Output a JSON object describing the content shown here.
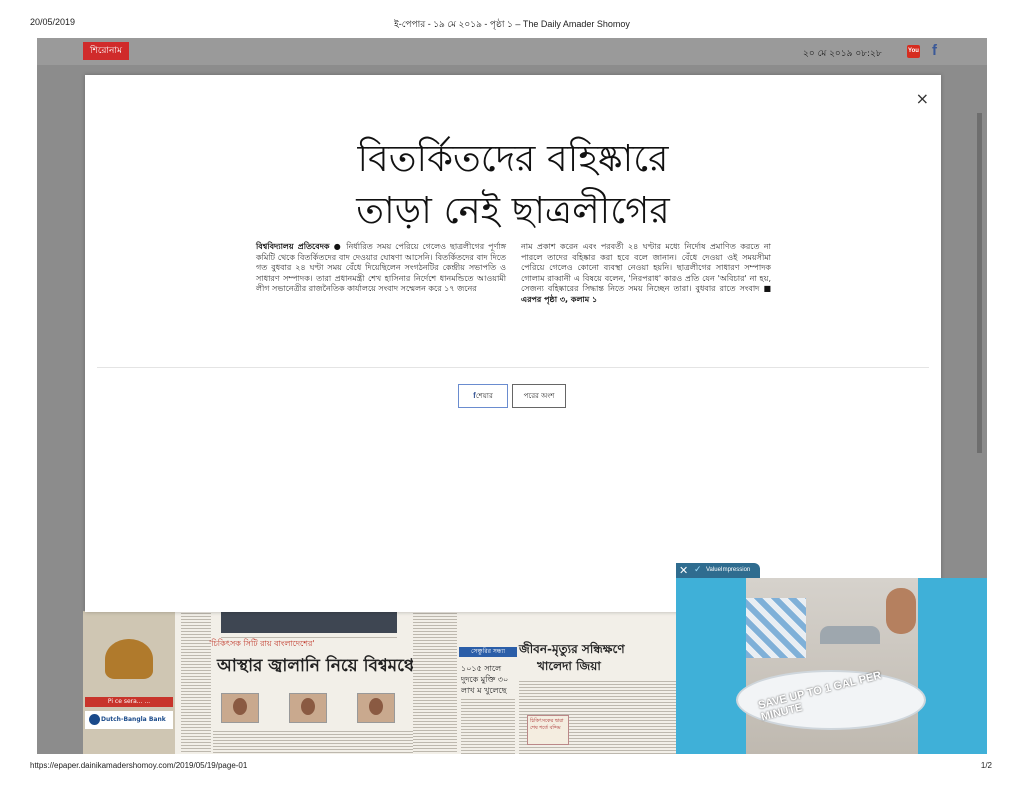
{
  "print_header": {
    "date": "20/05/2019",
    "title": "ই-পেপার - ১৯ মে ২০১৯ - পৃষ্ঠা ১ – The Daily Amader Shomoy"
  },
  "print_footer": {
    "url": "https://epaper.dainikamadershomoy.com/2019/05/19/page-01",
    "page": "1/2"
  },
  "topbar": {
    "headlines_label": "শিরোনাম",
    "datetime": "২০ মে ২০১৯ ০৮:২৮",
    "youtube_icon": "youtube-icon",
    "facebook_icon": "facebook-icon",
    "youtube_text": "You",
    "facebook_text": "f"
  },
  "modal": {
    "headline_line1": "বিতর্কিতদের বহিষ্কারে",
    "headline_line2": "তাড়া নেই ছাত্রলীগের",
    "byline": "বিশ্ববিদ্যালয় প্রতিবেদক ●",
    "left_column": "নির্ধারিত সময় পেরিয়ে গেলেও ছাত্রলীগের পূর্ণাঙ্গ কমিটি থেকে বিতর্কিতদের বাদ দেওয়ার ঘোষণা আসেনি। বিতর্কিতদের বাদ দিতে গত বুধবার ২৪ ঘণ্টা সময় বেঁধে দিয়েছিলেন সংগঠনটির কেন্দ্রীয় সভাপতি ও সাধারণ সম্পাদক। তারা প্রধানমন্ত্রী শেখ হাসিনার নির্দেশে ধানমন্ডিতে আওয়ামী লীগ সভানেত্রীর রাজনৈতিক কার্যালয়ে সংবাদ সম্মেলন করে ১৭ জনের",
    "right_column": "নাম প্রকাশ করেন এবং পরবর্তী ২৪ ঘণ্টার মধ্যে নির্দোষ প্রমাণিত করতে না পারলে তাদের বহিষ্কার করা হবে বলে জানান। বেঁধে দেওয়া ওই সময়সীমা পেরিয়ে গেলেও কোনো ব্যবস্থা নেওয়া হয়নি। ছাত্রলীগের সাধারণ সম্পাদক গোলাম রাব্বানী এ বিষয়ে বলেন, 'নিরপরাধ' কারও প্রতি যেন 'অবিচার' না হয়, সেজন্য বহিষ্কারের সিদ্ধান্ত নিতে সময় নিচ্ছেন তারা। বুধবার রাতে সংবাদ",
    "continued": "■ এরপর পৃষ্ঠা ৩, কলাম ১",
    "close_symbol": "×",
    "share_f": "f",
    "share_label": "শেয়ার",
    "next_label": "পরের অংশ"
  },
  "newspaper": {
    "strap": "'চিকিৎসক সিটি রায় বাংলাদেশের'",
    "main_headline": "আস্থার জ্বালানি নিয়ে বিশ্বমঞ্চে",
    "blue_tab": "সেঞ্চুরির সন্ধ্যা",
    "small_headline": "১০১৫ সালে দুদকে মুক্তি ৩০ লাখ ম খুলেছে",
    "mid_headline_line1": "জীবন-মৃত্যুর সন্ধিক্ষণে",
    "mid_headline_line2": "খালেদা জিয়া",
    "box_text": "চিকিৎসকের দ্বারা শেষ শর্তে বন্দিম",
    "ad_red": "Pi ce sera... ...",
    "ad_bank": "Dutch-Bangla Bank"
  },
  "video_ad": {
    "provider": "ValueImpression",
    "close_symbol": "✕",
    "check_symbol": "✓",
    "overlay_text": "SAVE UP TO 1 GAL PER MINUTE"
  },
  "colors": {
    "headline_red": "#d02b2b",
    "facebook_blue": "#3b5998",
    "youtube_red": "#d62d20",
    "overlay_gray": "#8c8c8c"
  }
}
